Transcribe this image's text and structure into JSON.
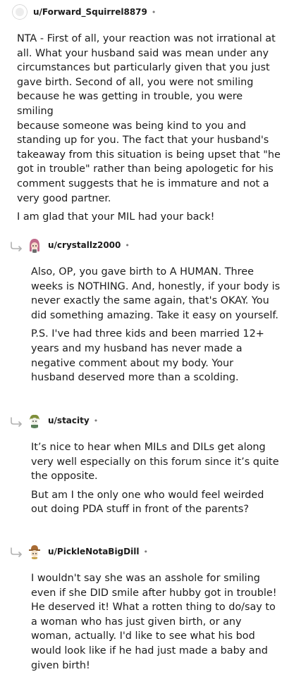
{
  "comments": [
    {
      "username": "u/Forward_Squirrel8879",
      "separator": "•",
      "avatar_icon": "default-user-avatar-icon",
      "paragraphs": [
        "NTA - First of all, your reaction was not irrational at\nall. What your husband said was mean under any\ncircumstances but particularly given that you just\ngave birth. Second of all, you were not smiling\nbecause he was getting in trouble, you were smiling\nbecause someone was being kind to you and\nstanding up for you. The fact that your husband's\ntakeaway from this situation is being upset that \"he\ngot in trouble\" rather than being apologetic for his\ncomment suggests that he is immature and not a\nvery good partner.",
        "I am glad that your MIL had your back!"
      ]
    },
    {
      "username": "u/crystallz2000",
      "separator": "•",
      "avatar_icon": "snoo-avatar-pink-hair-icon",
      "is_reply": true,
      "paragraphs": [
        "Also, OP, you gave birth to A HUMAN. Three\nweeks is NOTHING. And, honestly, if your body is\nnever exactly the same again, that's OKAY. You\ndid something amazing. Take it easy on yourself.",
        "P.S. I've had three kids and been married 12+\nyears and my husband has never made a\nnegative comment about my body. Your\nhusband deserved more than a scolding."
      ]
    },
    {
      "username": "u/stacity",
      "separator": "•",
      "avatar_icon": "snoo-avatar-green-icon",
      "is_reply": true,
      "paragraphs": [
        "It’s nice to hear when MILs and DILs get along\nvery well especially on this forum since it’s quite\nthe opposite.",
        "But am I the only one who would feel weirded\nout doing PDA stuff in front of the parents?"
      ]
    },
    {
      "username": "u/PickleNotaBigDill",
      "separator": "•",
      "avatar_icon": "snoo-avatar-hat-icon",
      "is_reply": true,
      "paragraphs": [
        "I wouldn't say she was an asshole for smiling\neven if she DID smile after hubby got in trouble!\nHe deserved it! What a rotten thing to do/say to\na woman who has just given birth, or any\nwoman, actually. I'd like to see what his bod\nwould look like if he had just made a baby and\ngiven birth!"
      ]
    }
  ]
}
